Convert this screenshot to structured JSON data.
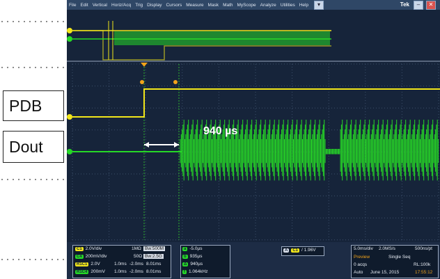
{
  "labels": {
    "pdb": "PDB",
    "dout": "Dout"
  },
  "menu": [
    "File",
    "Edit",
    "Vertical",
    "Horiz/Acq",
    "Trig",
    "Display",
    "Cursors",
    "Measure",
    "Mask",
    "Math",
    "MyScope",
    "Analyze",
    "Utilities",
    "Help"
  ],
  "brand": "Tek",
  "annotation": "940 µs",
  "channels": {
    "c1_marker": "1",
    "c4_marker": "4"
  },
  "colors": {
    "ch1": "#f2e61a",
    "ch4": "#26d926",
    "grid": "#3c4f6b",
    "panel": "#16243a"
  },
  "info": {
    "row1": {
      "chip": "C1",
      "scale": "2.0V/div",
      "imp": "1MΩ",
      "bw": "Bw:500M"
    },
    "row2": {
      "chip": "C4",
      "scale": "200mV/div",
      "imp": "50Ω",
      "bw": "Bw:2.5G"
    },
    "row3": {
      "chip": "R1C1",
      "v": "2.0V",
      "t1": "1.0ms",
      "t2": "-2.0ms",
      "t3": "8.01ms"
    },
    "row4": {
      "chip": "R1C4",
      "v": "200mV",
      "t1": "1.0ms",
      "t2": "-2.0ms",
      "t3": "8.01ms"
    },
    "cursors": [
      "-5.0µs",
      "935µs",
      "940µs",
      "1.064kHz"
    ],
    "trigger": {
      "chip": "C1",
      "level": "1.96V"
    },
    "timebase": {
      "tdiv": "5.0ms/div",
      "rate": "2.0MS/s",
      "res": "500ns/pt"
    },
    "mode": {
      "preview": "Preview",
      "seq": "Single Seq",
      "acqs": "0 acqs",
      "rl": "RL:100k",
      "auto": "Auto",
      "date": "June 15, 2015",
      "time": "17:55:12"
    }
  }
}
